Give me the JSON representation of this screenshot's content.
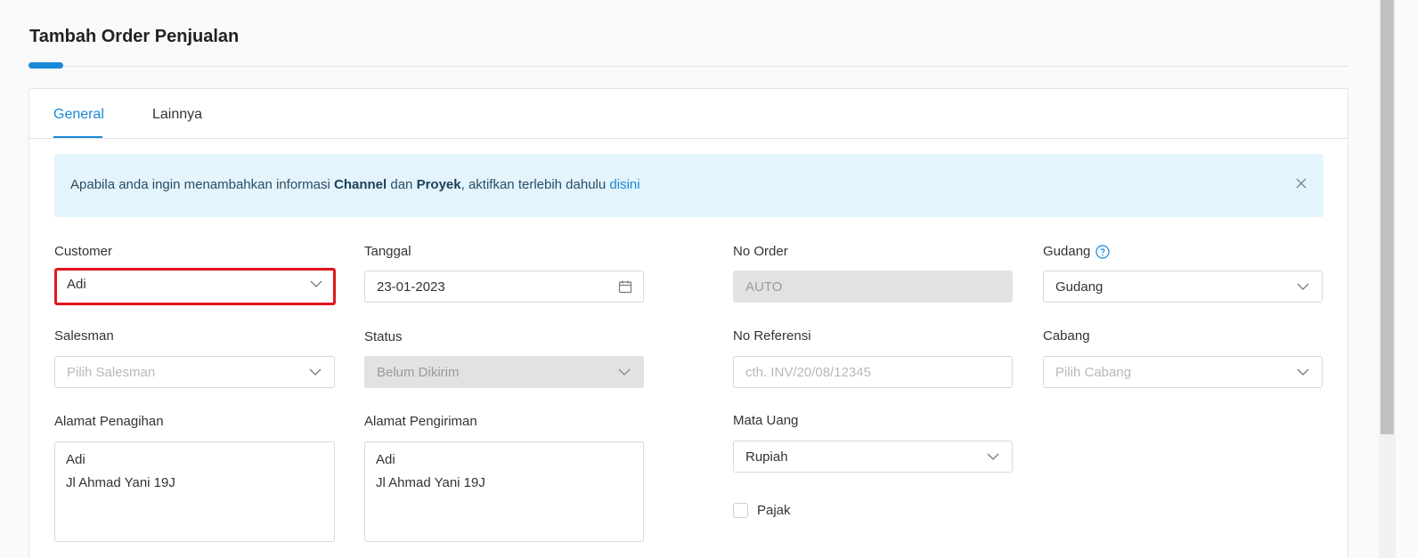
{
  "page": {
    "title": "Tambah Order Penjualan"
  },
  "tabs": [
    {
      "label": "General",
      "active": true
    },
    {
      "label": "Lainnya",
      "active": false
    }
  ],
  "alert": {
    "text_1": "Apabila anda ingin menambahkan informasi ",
    "strong_1": "Channel",
    "text_2": " dan ",
    "strong_2": "Proyek",
    "text_3": ", aktifkan terlebih dahulu ",
    "link": "disini"
  },
  "form": {
    "customer": {
      "label": "Customer",
      "value": "Adi"
    },
    "tanggal": {
      "label": "Tanggal",
      "value": "23-01-2023"
    },
    "no_order": {
      "label": "No Order",
      "value": "AUTO"
    },
    "gudang": {
      "label": "Gudang",
      "value": "Gudang"
    },
    "salesman": {
      "label": "Salesman",
      "placeholder": "Pilih Salesman"
    },
    "status": {
      "label": "Status",
      "value": "Belum Dikirim"
    },
    "no_referensi": {
      "label": "No Referensi",
      "placeholder": "cth. INV/20/08/12345"
    },
    "cabang": {
      "label": "Cabang",
      "placeholder": "Pilih Cabang"
    },
    "alamat_penagihan": {
      "label": "Alamat Penagihan",
      "lines": [
        "Adi",
        "Jl Ahmad Yani 19J"
      ]
    },
    "alamat_pengiriman": {
      "label": "Alamat Pengiriman",
      "lines": [
        "Adi",
        "Jl Ahmad Yani 19J"
      ]
    },
    "mata_uang": {
      "label": "Mata Uang",
      "value": "Rupiah"
    },
    "pajak": {
      "label": "Pajak",
      "checked": false
    }
  },
  "colors": {
    "accent": "#1a88d6",
    "highlight": "#e2151e",
    "alert_bg": "#e3f4fc"
  },
  "icons": {
    "dropdown": "chevron-down-icon",
    "calendar": "calendar-icon",
    "close": "close-icon",
    "help": "help-circle-icon"
  }
}
